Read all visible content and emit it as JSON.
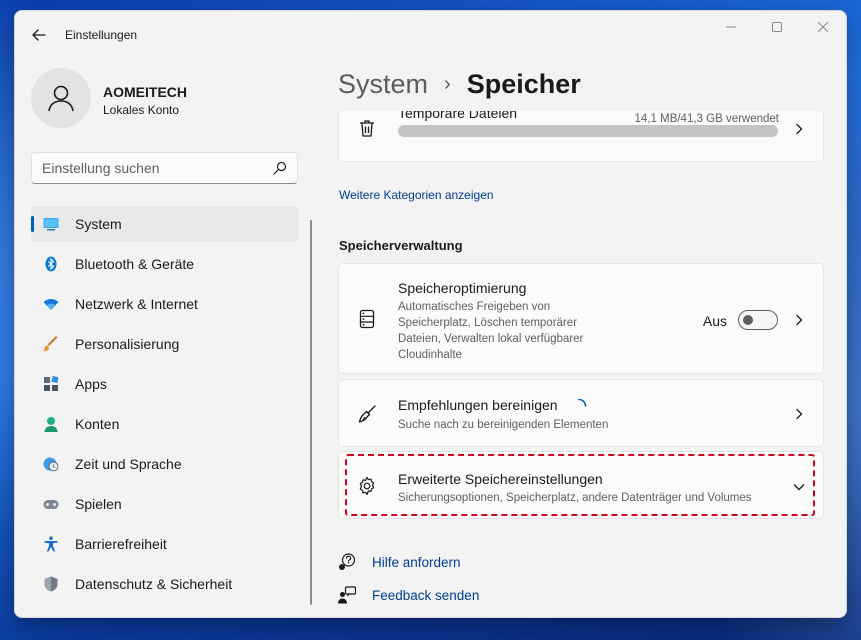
{
  "window": {
    "app_title": "Einstellungen"
  },
  "profile": {
    "name": "AOMEITECH",
    "account_type": "Lokales Konto"
  },
  "search": {
    "placeholder": "Einstellung suchen"
  },
  "nav": {
    "items": [
      {
        "label": "System",
        "icon": "monitor-icon",
        "active": true
      },
      {
        "label": "Bluetooth & Geräte",
        "icon": "bluetooth-icon"
      },
      {
        "label": "Netzwerk & Internet",
        "icon": "wifi-icon"
      },
      {
        "label": "Personalisierung",
        "icon": "brush-icon"
      },
      {
        "label": "Apps",
        "icon": "apps-icon"
      },
      {
        "label": "Konten",
        "icon": "person-icon"
      },
      {
        "label": "Zeit und Sprache",
        "icon": "globe-clock-icon"
      },
      {
        "label": "Spielen",
        "icon": "gamepad-icon"
      },
      {
        "label": "Barrierefreiheit",
        "icon": "accessibility-icon"
      },
      {
        "label": "Datenschutz & Sicherheit",
        "icon": "shield-icon"
      }
    ]
  },
  "breadcrumb": {
    "parent": "System",
    "separator": "›",
    "current": "Speicher"
  },
  "content": {
    "temp_files": {
      "title": "Temporäre Dateien",
      "usage": "14,1 MB/41,3 GB verwendet",
      "usage_fraction": 0.0
    },
    "more_categories": "Weitere Kategorien anzeigen",
    "section_header": "Speicherverwaltung",
    "storage_sense": {
      "title": "Speicheroptimierung",
      "desc_lines": [
        "Automatisches Freigeben von",
        "Speicherplatz, Löschen temporärer",
        "Dateien, Verwalten lokal verfügbarer",
        "Cloudinhalte"
      ],
      "toggle_label": "Aus",
      "toggle_on": false
    },
    "cleanup": {
      "title": "Empfehlungen bereinigen",
      "desc": "Suche nach zu bereinigenden Elementen"
    },
    "advanced": {
      "title": "Erweiterte Speichereinstellungen",
      "desc": "Sicherungsoptionen, Speicherplatz, andere Datenträger und Volumes"
    },
    "help": {
      "get_help": "Hilfe anfordern",
      "feedback": "Feedback senden"
    }
  },
  "colors": {
    "accent": "#005fb8",
    "link": "#003e92",
    "highlight": "#d0021b"
  }
}
